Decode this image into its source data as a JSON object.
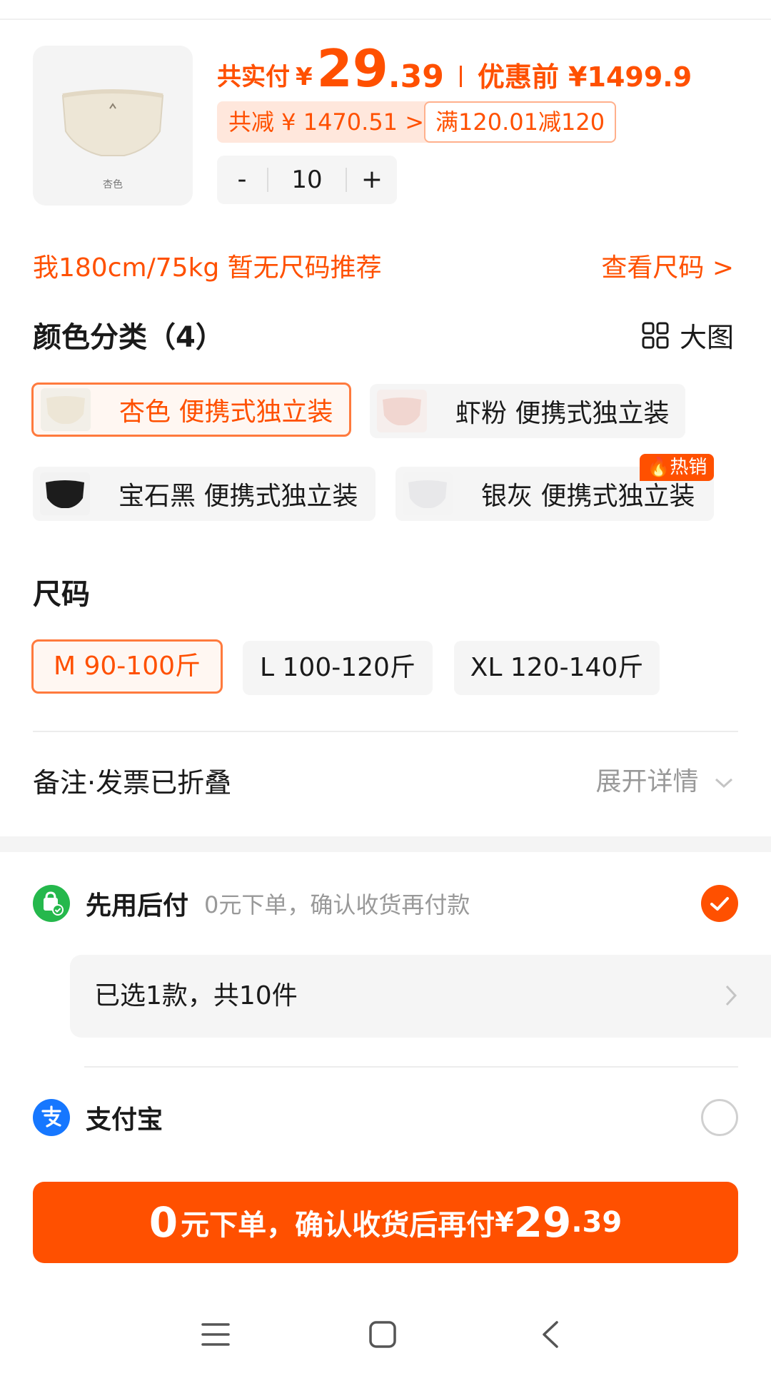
{
  "order": {
    "price_label": "共实付",
    "currency": "¥",
    "price_int": "29",
    "price_dot": ".",
    "price_dec": "39",
    "original_price": "优惠前 ¥1499.9",
    "saved_tag": "共减 ¥ 1470.51 >",
    "coupon_tag": "满120.01减120",
    "quantity": "10",
    "qty_minus": "-",
    "qty_plus": "+",
    "thumb_label": "杏色"
  },
  "size_recommend": {
    "text": "我180cm/75kg 暂无尺码推荐",
    "link": "查看尺码 >"
  },
  "color_section": {
    "title": "颜色分类（4）",
    "big_pic": "大图",
    "hot_badge": "🔥热销",
    "options": [
      {
        "label": "杏色 便携式独立装"
      },
      {
        "label": "虾粉 便携式独立装"
      },
      {
        "label": "宝石黑 便携式独立装"
      },
      {
        "label": "银灰 便携式独立装"
      }
    ]
  },
  "size_section": {
    "title": "尺码",
    "options": [
      {
        "label": "M 90-100斤"
      },
      {
        "label": "L 100-120斤"
      },
      {
        "label": "XL 120-140斤"
      }
    ]
  },
  "notes": {
    "label": "备注·发票已折叠",
    "expand": "展开详情"
  },
  "payment": {
    "pay_later_name": "先用后付",
    "pay_later_sub": "0元下单，确认收货再付款",
    "selected_summary": "已选1款，共10件",
    "alipay_name": "支付宝"
  },
  "cta": {
    "part0": "0",
    "part1": "元下单，确认收货后再付",
    "part2": "¥",
    "part3": "29",
    "part4": ".39"
  },
  "colors": {
    "accent": "#ff5000",
    "pay_later_green": "#25b84c",
    "alipay_blue": "#1677ff"
  }
}
